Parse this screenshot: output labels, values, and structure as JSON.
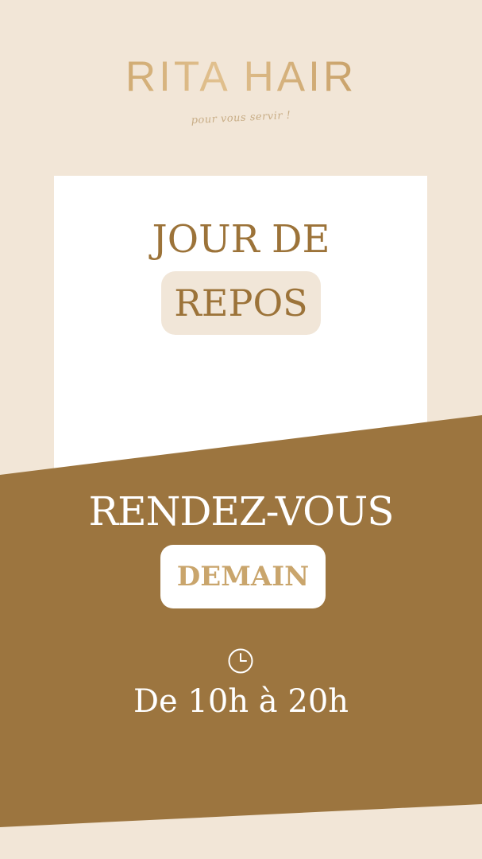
{
  "brand": {
    "name": "RITA HAIR",
    "tagline": "pour vous servir !"
  },
  "closed_notice": {
    "line1": "JOUR DE",
    "line2": "REPOS"
  },
  "appointment": {
    "line1": "RENDEZ-VOUS",
    "highlight": "DEMAIN"
  },
  "schedule": {
    "icon": "clock-icon",
    "hours": "De 10h à 20h"
  },
  "colors": {
    "background": "#f2e6d7",
    "accent_brown": "#9c753f",
    "gold": "#c49d5c",
    "card": "#ffffff"
  }
}
